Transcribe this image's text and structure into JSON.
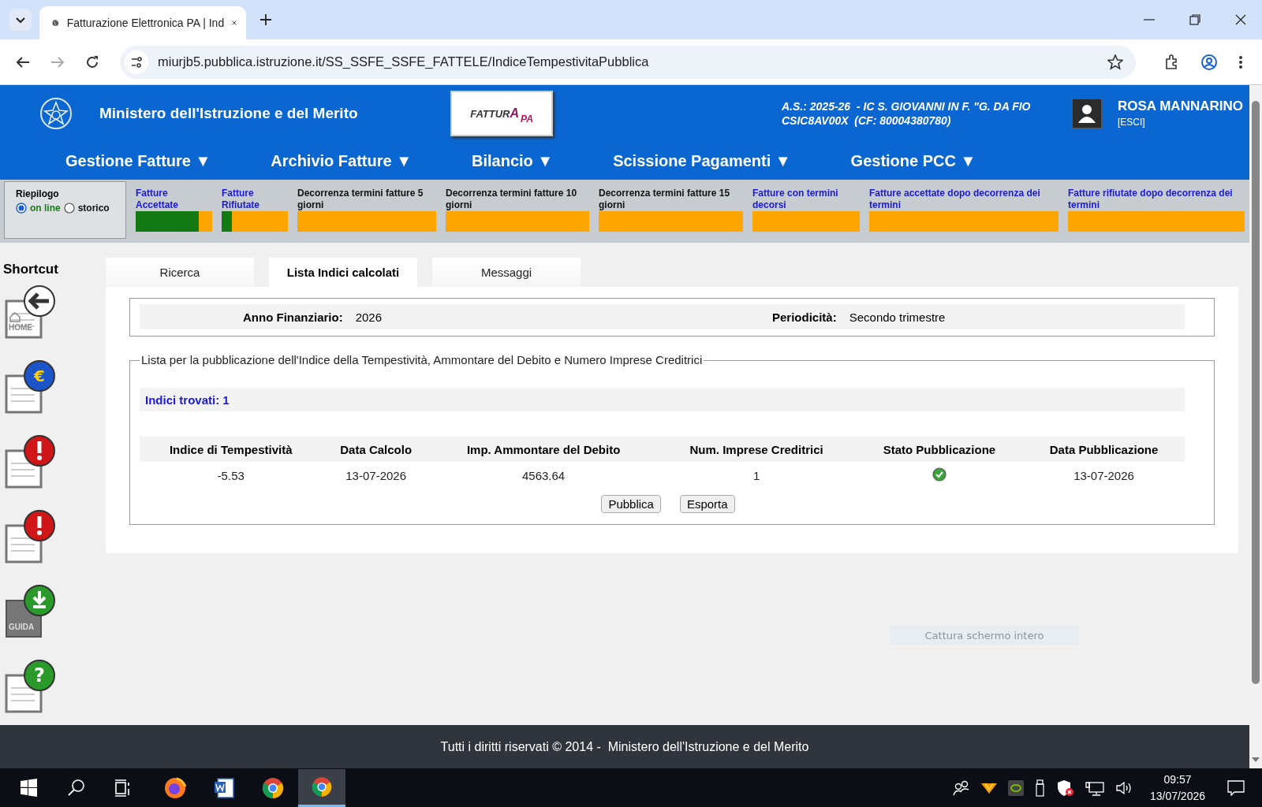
{
  "browser": {
    "tab_title": "Fatturazione Elettronica PA | Ind",
    "url": "miurjb5.pubblica.istruzione.it/SS_SSFE_SSFE_FATTELE/IndiceTempestivitaPubblica"
  },
  "header": {
    "ministry": "Ministero dell'Istruzione e del Merito",
    "logo": [
      "FATTUR",
      "A",
      "PA"
    ],
    "school_line1": "A.S.: 2025-26  - IC S. GIOVANNI IN F. \"G. DA FIO",
    "school_line2": "CSIC8AV00X  (CF: 80004380780)",
    "user_name": "ROSA MANNARINO",
    "logout": "[ESCI]"
  },
  "menu": [
    "Gestione Fatture ▼",
    "Archivio Fatture ▼",
    "Bilancio ▼",
    "Scissione Pagamenti ▼",
    "Gestione PCC ▼"
  ],
  "summary": {
    "title": "Riepilogo",
    "options": [
      {
        "label": "on line",
        "selected": true
      },
      {
        "label": "storico",
        "selected": false
      }
    ]
  },
  "indicators": [
    {
      "label": "Fatture Accettate",
      "kind": "link",
      "level": 0.82
    },
    {
      "label": "Fatture Rifiutate",
      "kind": "link",
      "level": 0.16
    },
    {
      "label": "Decorrenza termini fatture 5 giorni",
      "kind": "text",
      "level": 0
    },
    {
      "label": "Decorrenza termini fatture 10 giorni",
      "kind": "text",
      "level": 0
    },
    {
      "label": "Decorrenza termini fatture 15 giorni",
      "kind": "text",
      "level": 0
    },
    {
      "label": "Fatture con termini decorsi",
      "kind": "link",
      "level": 0
    },
    {
      "label": "Fatture accettate dopo decorrenza dei termini",
      "kind": "link",
      "level": 0
    },
    {
      "label": "Fatture rifiutate dopo decorrenza dei termini",
      "kind": "link",
      "level": 0
    }
  ],
  "shortcut": {
    "title": "Shortcut",
    "items": [
      {
        "kind": "home",
        "label": "HOME"
      },
      {
        "kind": "euro",
        "symbol": "€"
      },
      {
        "kind": "alert"
      },
      {
        "kind": "alert"
      },
      {
        "kind": "guide",
        "label": "GUIDA"
      },
      {
        "kind": "help",
        "symbol": "?"
      }
    ]
  },
  "tabs": [
    {
      "label": "Ricerca",
      "selected": false
    },
    {
      "label": "Lista Indici calcolati",
      "selected": true
    },
    {
      "label": "Messaggi",
      "selected": false
    }
  ],
  "filter": [
    {
      "label": "Anno Finanziario:",
      "value": "2026"
    },
    {
      "label": "Periodicità:",
      "value": "Secondo trimestre"
    }
  ],
  "list": {
    "legend": "Lista per la pubblicazione dell'Indice della Tempestività, Ammontare del Debito e Numero Imprese Creditrici",
    "found": "Indici trovati: 1",
    "columns": [
      "Indice di Tempestività",
      "Data Calcolo",
      "Imp. Ammontare del Debito",
      "Num. Imprese Creditrici",
      "Stato Pubblicazione",
      "Data Pubblicazione"
    ],
    "rows": [
      {
        "values": [
          "-5.53",
          "13-07-2026",
          "4563.64",
          "1"
        ],
        "published": true,
        "published_date": "13-07-2026"
      }
    ]
  },
  "buttons": [
    "Pubblica",
    "Esporta"
  ],
  "capture_button": "Cattura schermo intero",
  "footer": "Tutti i diritti riservati © 2014 -  Ministero dell'Istruzione e del Merito",
  "taskbar": {
    "apps": [
      {
        "kind": "firefox",
        "active": false
      },
      {
        "kind": "word",
        "active": false
      },
      {
        "kind": "chrome",
        "active": false
      },
      {
        "kind": "chrome",
        "active": true
      }
    ],
    "time": "09:57",
    "date": "13/07/2026"
  }
}
